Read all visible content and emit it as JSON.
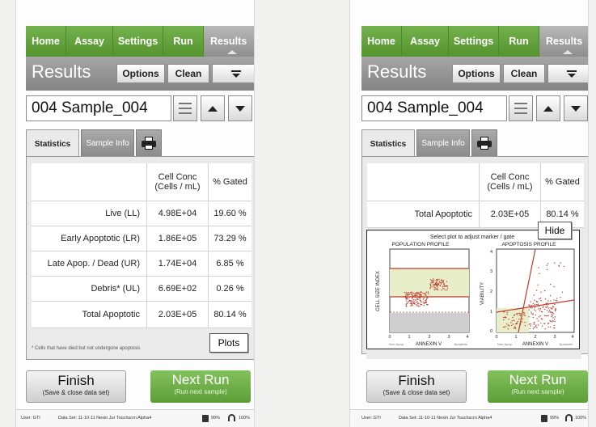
{
  "nav": {
    "tabs": [
      "Home",
      "Assay",
      "Settings",
      "Run",
      "Results"
    ],
    "active": "Results"
  },
  "results": {
    "title": "Results",
    "options": "Options",
    "clean": "Clean"
  },
  "sample": {
    "name": "004 Sample_004"
  },
  "tabs": {
    "statistics": "Statistics",
    "sample_info": "Sample Info"
  },
  "table": {
    "col_conc": "Cell Conc (Cells / mL)",
    "col_gated": "% Gated",
    "rows": [
      {
        "label": "Live (LL)",
        "conc": "4.98E+04",
        "gated": "19.60 %"
      },
      {
        "label": "Early Apoptotic (LR)",
        "conc": "1.86E+05",
        "gated": "73.29 %"
      },
      {
        "label": "Late Apop. / Dead (UR)",
        "conc": "1.74E+04",
        "gated": "6.85 %"
      },
      {
        "label": "Debris* (UL)",
        "conc": "6.69E+02",
        "gated": "0.26 %"
      },
      {
        "label": "Total Apoptotic",
        "conc": "2.03E+05",
        "gated": "80.14 %"
      }
    ],
    "footnote": "* Cells that have died but not undergone apoptosis",
    "plots_button": "Plots"
  },
  "plots": {
    "hide_button": "Hide",
    "instruction": "Select plot to adjust marker / gate",
    "population": {
      "title": "POPULATION PROFILE",
      "ylabel": "CELL SIZE INDEX",
      "xlabel": "ANNEXIN V",
      "x_left": "Non-Apop",
      "x_right": "Apoptotic",
      "ticks": [
        "0",
        "1",
        "2",
        "3",
        "4"
      ]
    },
    "apoptosis": {
      "title": "APOPTOSIS PROFILE",
      "ylabel": "VIABILITY",
      "xlabel": "ANNEXIN V",
      "x_left": "Non-Apop",
      "x_right": "Apoptotic",
      "ticks": [
        "0",
        "1",
        "2",
        "3",
        "4"
      ],
      "yticks": [
        "0",
        "1",
        "2",
        "3",
        "4"
      ]
    }
  },
  "buttons": {
    "finish": "Finish",
    "finish_sub": "(Save & close data set)",
    "next": "Next Run",
    "next_sub": "(Run next sample)"
  },
  "status": {
    "user": "User: GTI",
    "dataset": "Data Set: 11-10-11 Nexin Jur Touchscrn Alpha4",
    "battery": "99%",
    "wifi": "100%"
  }
}
